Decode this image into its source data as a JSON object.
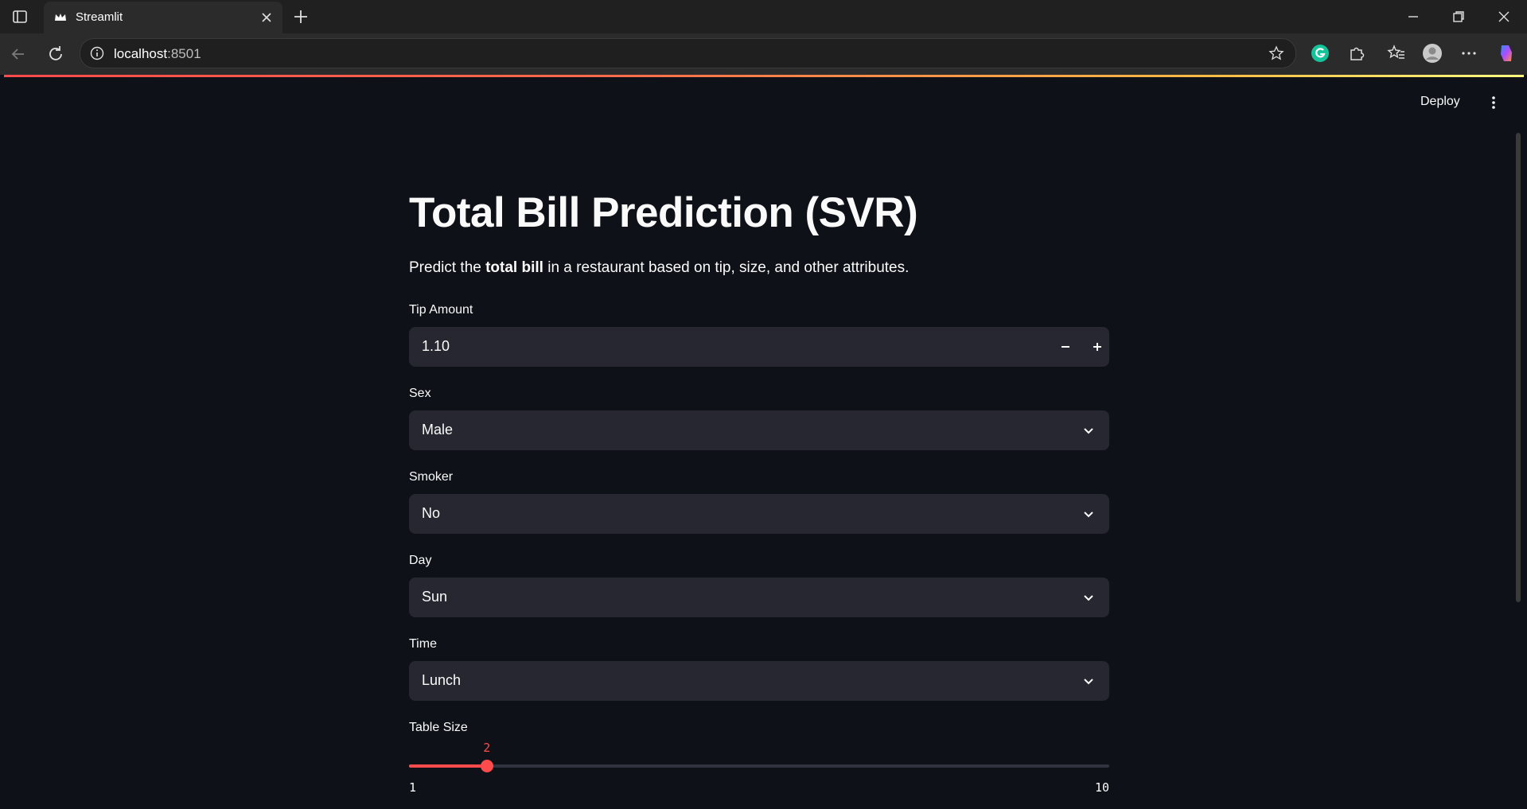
{
  "browser": {
    "tab_title": "Streamlit",
    "url_host": "localhost",
    "url_port": ":8501"
  },
  "header": {
    "deploy_label": "Deploy"
  },
  "main": {
    "title": "Total Bill Prediction (SVR)",
    "description_prefix": "Predict the ",
    "description_bold": "total bill",
    "description_suffix": " in a restaurant based on tip, size, and other attributes.",
    "tip": {
      "label": "Tip Amount",
      "value": "1.10"
    },
    "sex": {
      "label": "Sex",
      "value": "Male"
    },
    "smoker": {
      "label": "Smoker",
      "value": "No"
    },
    "day": {
      "label": "Day",
      "value": "Sun"
    },
    "time": {
      "label": "Time",
      "value": "Lunch"
    },
    "table_size": {
      "label": "Table Size",
      "value": 2,
      "value_text": "2",
      "min": 1,
      "max": 10,
      "min_text": "1",
      "max_text": "10"
    }
  },
  "colors": {
    "accent": "#ff4b4b",
    "background": "#0e1117",
    "input_background": "#262730"
  },
  "icons": [
    "sidebar-icon",
    "streamlit-crown-icon",
    "close-icon",
    "plus-icon",
    "minimize-icon",
    "restore-icon",
    "back-icon",
    "reload-icon",
    "info-icon",
    "star-icon",
    "grammarly-icon",
    "extensions-icon",
    "favorites-icon",
    "profile-icon",
    "more-icon",
    "copilot-icon",
    "kebab-menu-icon",
    "minus-icon",
    "chevron-down-icon"
  ]
}
